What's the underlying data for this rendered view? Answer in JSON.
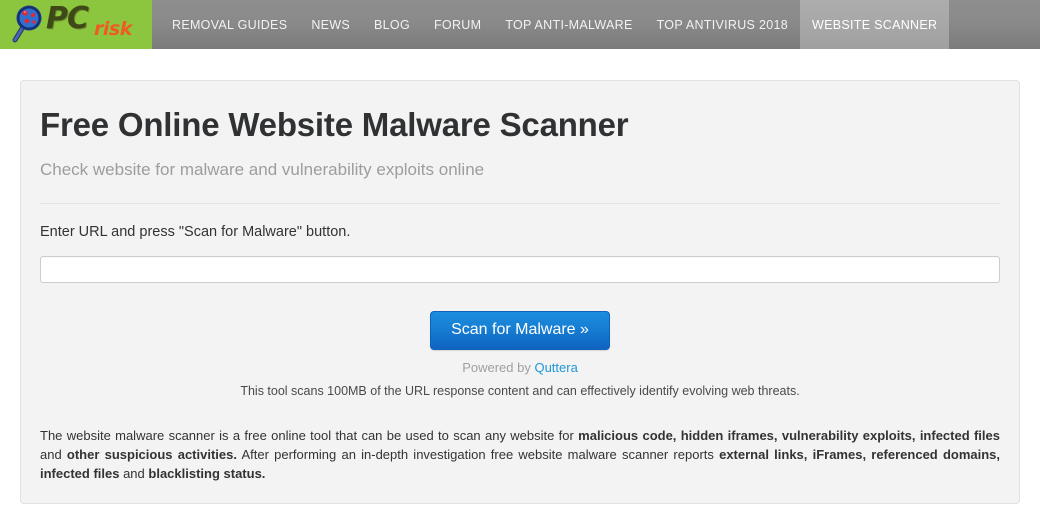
{
  "header": {
    "logo": {
      "icon": "magnifying-glass-icon",
      "text_primary": "PC",
      "text_secondary": "risk"
    },
    "nav_items": [
      {
        "label": "REMOVAL GUIDES",
        "active": false
      },
      {
        "label": "NEWS",
        "active": false
      },
      {
        "label": "BLOG",
        "active": false
      },
      {
        "label": "FORUM",
        "active": false
      },
      {
        "label": "TOP ANTI-MALWARE",
        "active": false
      },
      {
        "label": "TOP ANTIVIRUS 2018",
        "active": false
      },
      {
        "label": "WEBSITE SCANNER",
        "active": true
      }
    ]
  },
  "main": {
    "title": "Free Online Website Malware Scanner",
    "subtitle": "Check website for malware and vulnerability exploits online",
    "instruction": "Enter URL and press \"Scan for Malware\" button.",
    "url_input_value": "",
    "url_input_placeholder": "",
    "scan_button_label": "Scan for Malware »",
    "powered_prefix": "Powered by ",
    "powered_link": "Quttera",
    "scan_note": "This tool scans 100MB of the URL response content and can effectively identify evolving web threats.",
    "description": {
      "seg1": "The website malware scanner is a free online tool that can be used to scan any website for ",
      "bold1": "malicious code, hidden iframes, vulnerability exploits, infected files",
      "seg2": " and ",
      "bold2": "other suspicious activities.",
      "seg3": " After performing an in-depth investigation free website malware scanner reports ",
      "bold3": "external links, iFrames, referenced domains, infected files",
      "seg4": " and ",
      "bold4": "blacklisting status."
    }
  },
  "colors": {
    "logo_green": "#8cc63e",
    "logo_orange": "#f15a22",
    "nav_gray": "#8a8a8a",
    "nav_active_gray": "#a6a6a6",
    "panel_bg": "#f3f3f3",
    "button_blue": "#1780d4",
    "link_blue": "#2196d6"
  }
}
